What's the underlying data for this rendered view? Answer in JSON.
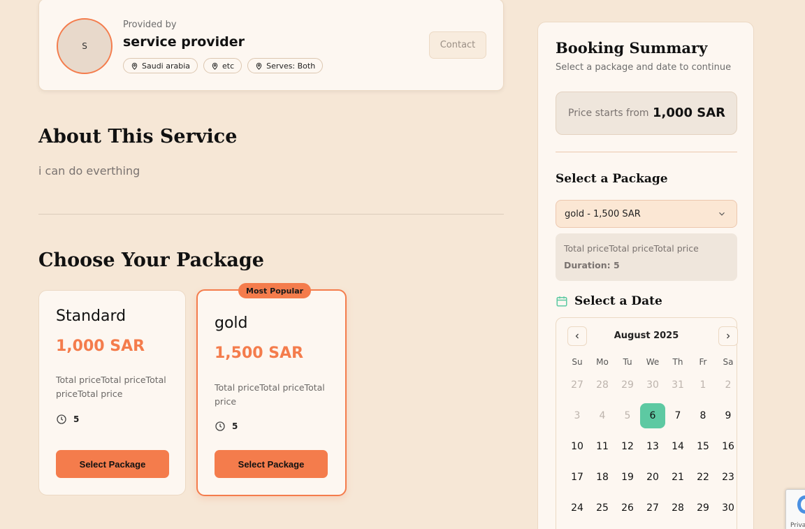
{
  "provider": {
    "avatar_initial": "S",
    "provided_by": "Provided by",
    "name": "service provider",
    "tags": [
      "Saudi arabia",
      "etc",
      "Serves: Both"
    ],
    "contact_label": "Contact"
  },
  "about": {
    "title": "About This Service",
    "text": "i can do everthing"
  },
  "packages": {
    "title": "Choose Your Package",
    "items": [
      {
        "name": "Standard",
        "price": "1,000 SAR",
        "description": "Total priceTotal priceTotal priceTotal price",
        "duration": "5",
        "button": "Select Package",
        "badge": ""
      },
      {
        "name": "gold",
        "price": "1,500 SAR",
        "description": "Total priceTotal priceTotal price",
        "duration": "5",
        "button": "Select Package",
        "badge": "Most Popular"
      }
    ]
  },
  "summary": {
    "title": "Booking Summary",
    "subtitle": "Select a package and date to continue",
    "price_label": "Price starts from",
    "price_value": "1,000 SAR",
    "select_package_title": "Select a Package",
    "selected_package": "gold - 1,500 SAR",
    "package_description": "Total priceTotal priceTotal price",
    "package_duration": "Duration: 5",
    "select_date_title": "Select a Date"
  },
  "calendar": {
    "month": "August 2025",
    "weekdays": [
      "Su",
      "Mo",
      "Tu",
      "We",
      "Th",
      "Fr",
      "Sa"
    ],
    "days": [
      {
        "d": "27",
        "muted": true
      },
      {
        "d": "28",
        "muted": true
      },
      {
        "d": "29",
        "muted": true
      },
      {
        "d": "30",
        "muted": true
      },
      {
        "d": "31",
        "muted": true
      },
      {
        "d": "1",
        "muted": true
      },
      {
        "d": "2",
        "muted": true
      },
      {
        "d": "3",
        "muted": true
      },
      {
        "d": "4",
        "muted": true
      },
      {
        "d": "5",
        "muted": true
      },
      {
        "d": "6",
        "selected": true
      },
      {
        "d": "7"
      },
      {
        "d": "8"
      },
      {
        "d": "9"
      },
      {
        "d": "10"
      },
      {
        "d": "11"
      },
      {
        "d": "12"
      },
      {
        "d": "13"
      },
      {
        "d": "14"
      },
      {
        "d": "15"
      },
      {
        "d": "16"
      },
      {
        "d": "17"
      },
      {
        "d": "18"
      },
      {
        "d": "19"
      },
      {
        "d": "20"
      },
      {
        "d": "21"
      },
      {
        "d": "22"
      },
      {
        "d": "23"
      },
      {
        "d": "24"
      },
      {
        "d": "25"
      },
      {
        "d": "26"
      },
      {
        "d": "27"
      },
      {
        "d": "28"
      },
      {
        "d": "29"
      },
      {
        "d": "30"
      }
    ]
  },
  "recaptcha": {
    "text": "Privacy"
  },
  "colors": {
    "accent": "#f47c4c",
    "selected_day": "#5dc9a2",
    "background": "#f6e7d6"
  }
}
